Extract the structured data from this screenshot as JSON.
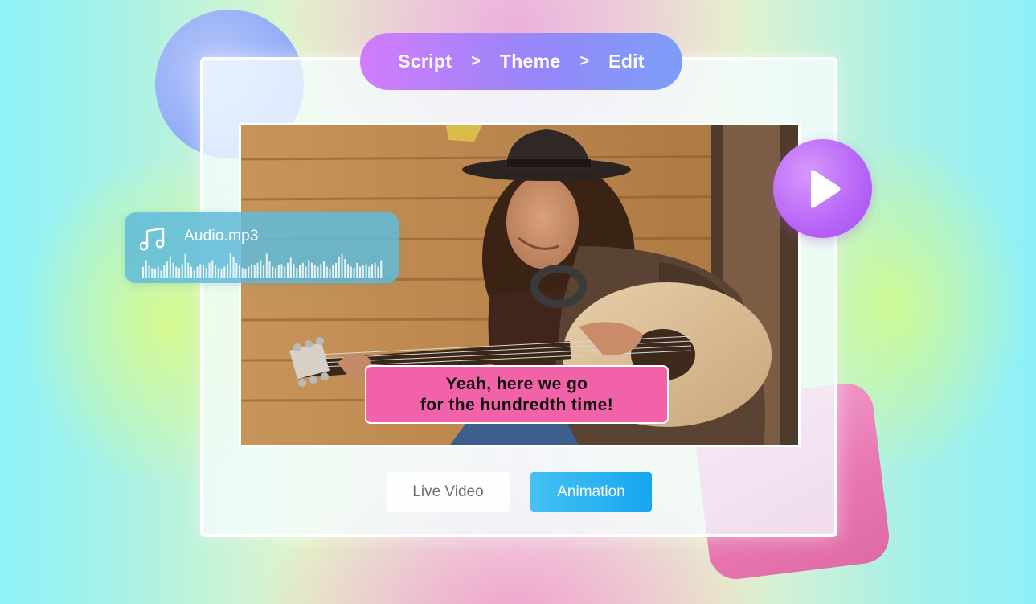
{
  "steps": [
    {
      "label": "Script"
    },
    {
      "label": "Theme"
    },
    {
      "label": "Edit"
    }
  ],
  "step_separator": ">",
  "audio": {
    "filename": "Audio.mp3",
    "icon": "music-note-icon",
    "waveform_levels": [
      0.45,
      0.7,
      0.5,
      0.4,
      0.35,
      0.45,
      0.3,
      0.5,
      0.65,
      0.85,
      0.6,
      0.45,
      0.4,
      0.55,
      0.95,
      0.6,
      0.45,
      0.3,
      0.45,
      0.55,
      0.5,
      0.4,
      0.6,
      0.7,
      0.5,
      0.4,
      0.35,
      0.45,
      0.55,
      1.0,
      0.85,
      0.6,
      0.5,
      0.4,
      0.35,
      0.45,
      0.55,
      0.5,
      0.6,
      0.7,
      0.5,
      0.95,
      0.65,
      0.45,
      0.4,
      0.5,
      0.55,
      0.45,
      0.6,
      0.8,
      0.55,
      0.4,
      0.5,
      0.6,
      0.45,
      0.7,
      0.6,
      0.5,
      0.45,
      0.55,
      0.65,
      0.45,
      0.35,
      0.5,
      0.6,
      0.85,
      0.95,
      0.75,
      0.55,
      0.45,
      0.4,
      0.6,
      0.45,
      0.5,
      0.55,
      0.45,
      0.55,
      0.6,
      0.45,
      0.7
    ]
  },
  "player": {
    "play_icon": "play-icon"
  },
  "caption": {
    "line1": "Yeah, here we go",
    "line2": "for the hundredth time!"
  },
  "buttons": {
    "live_video": "Live Video",
    "animation": "Animation"
  },
  "colors": {
    "steps_start": "#d27cfb",
    "steps_end": "#7b9ff8",
    "caption_bg": "#f262a8",
    "animation_btn": "#16a6f0",
    "play_btn": "#b764f6",
    "audio_card": "#60bada"
  }
}
